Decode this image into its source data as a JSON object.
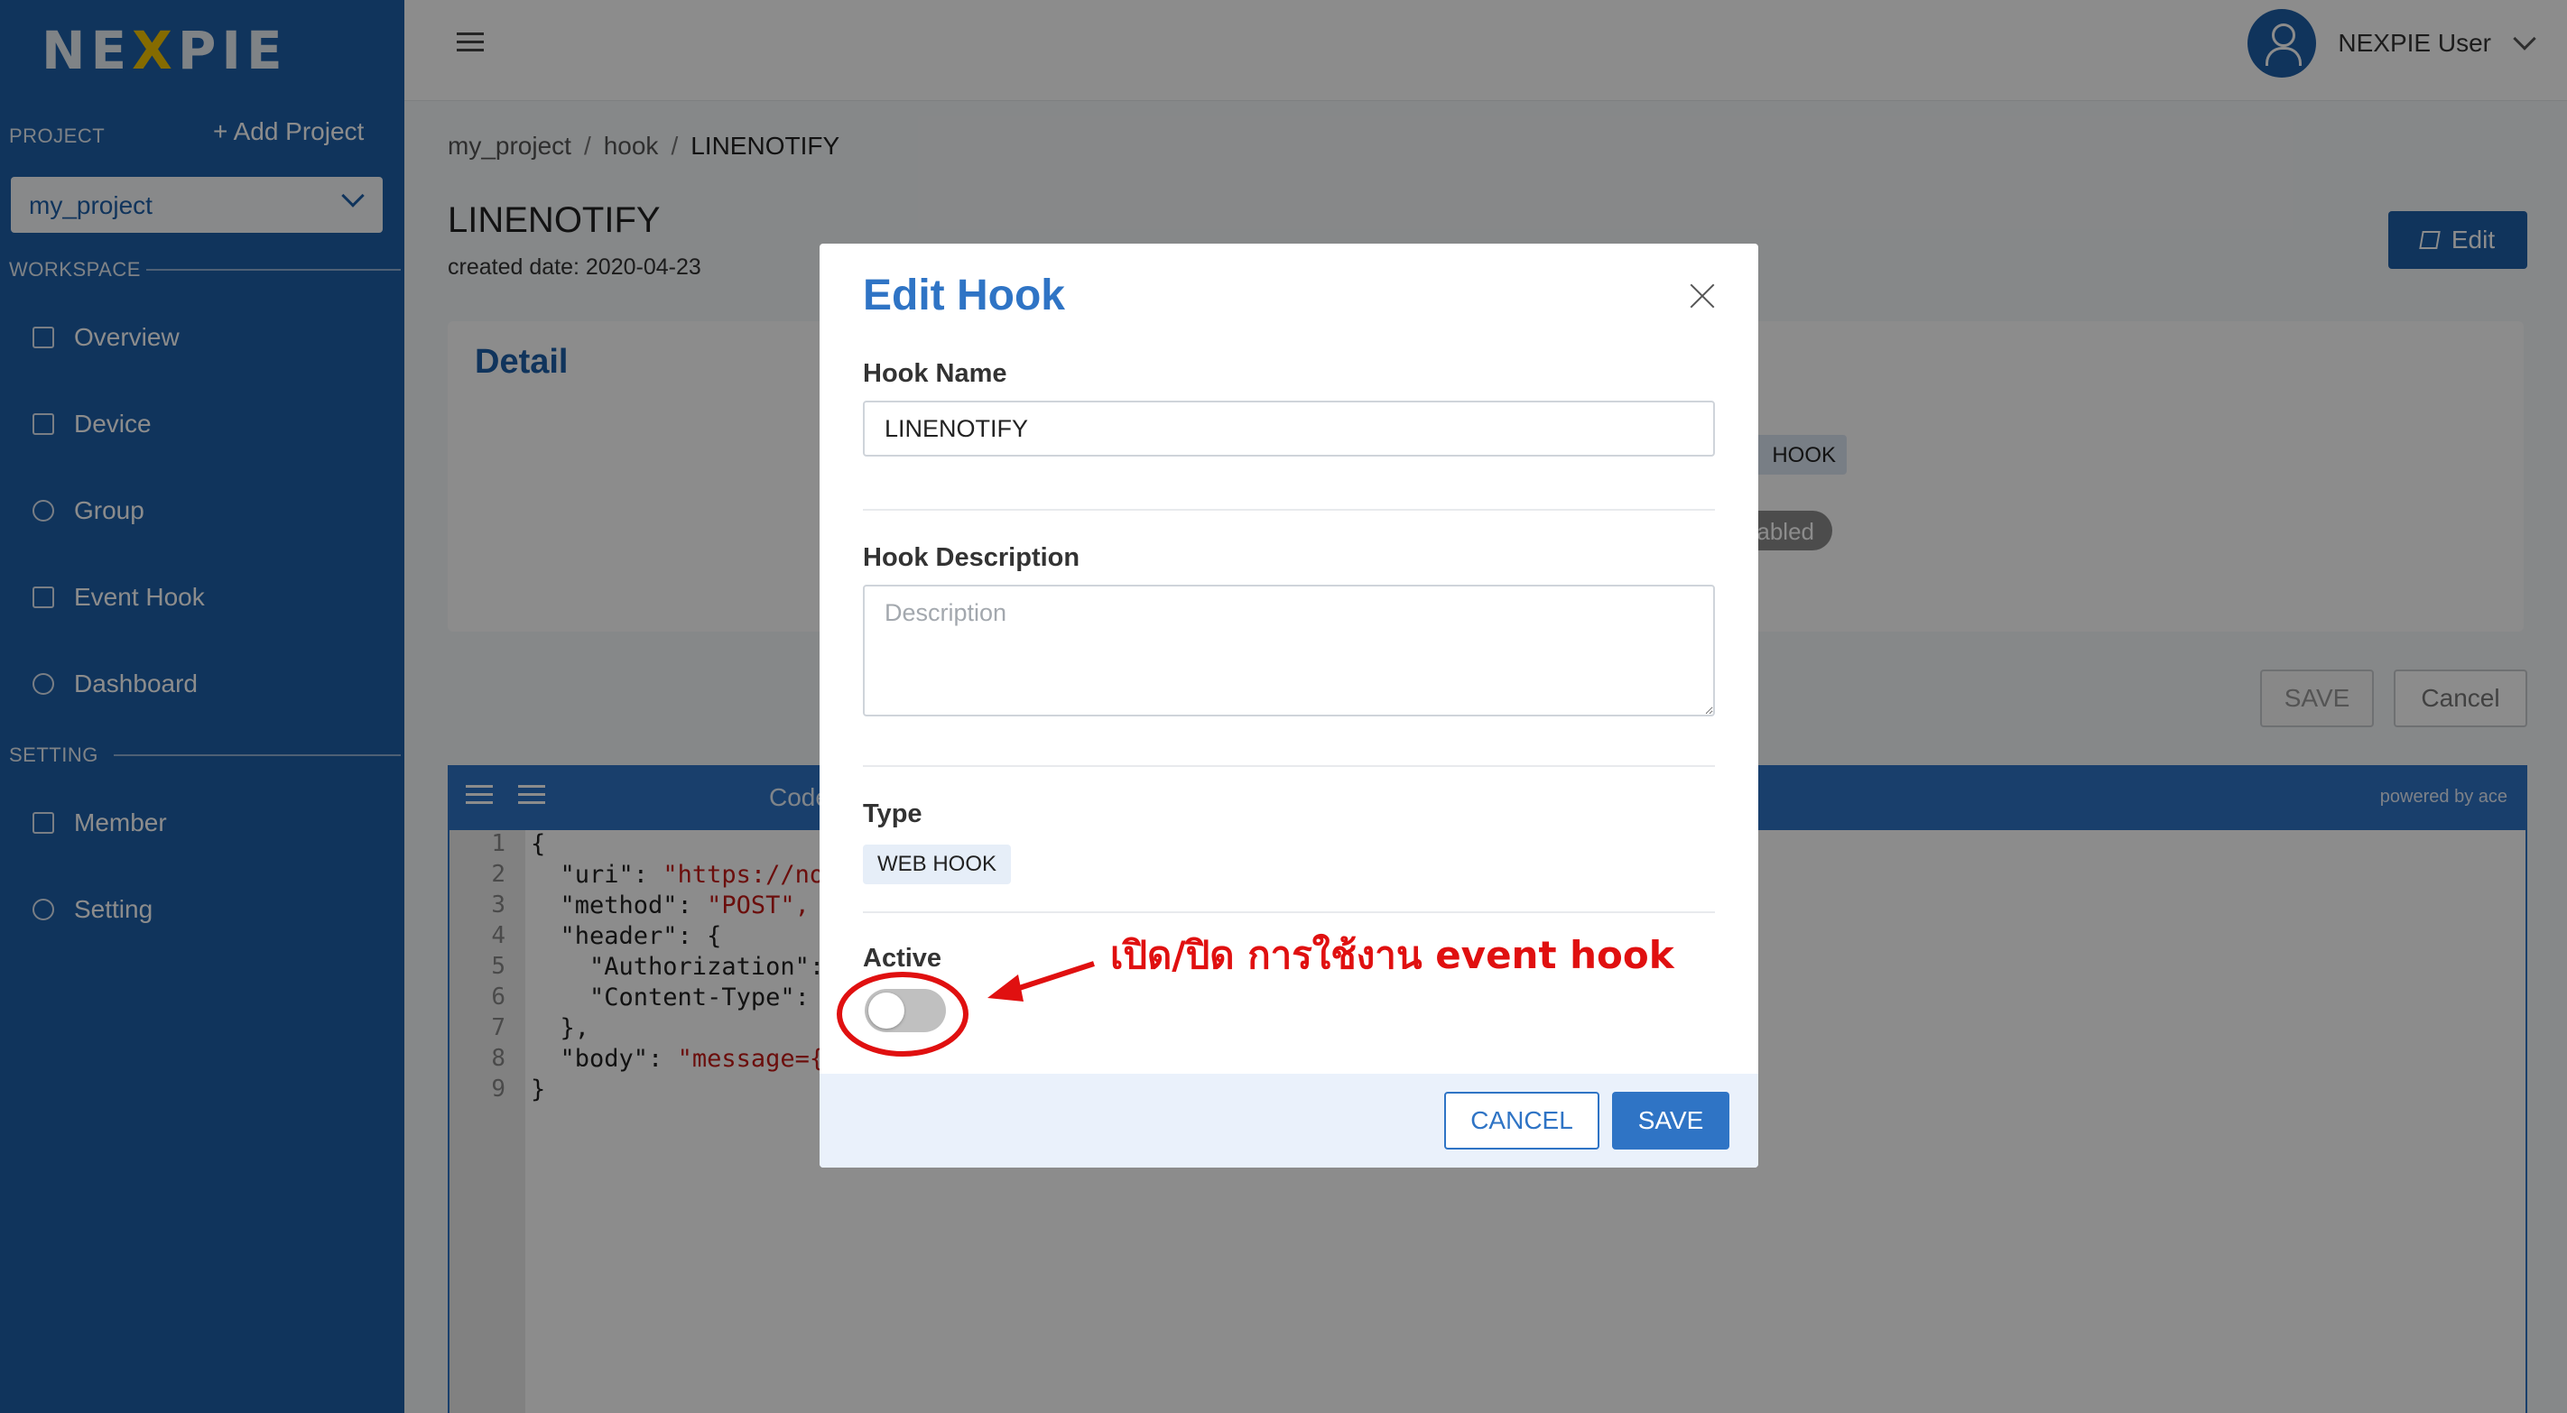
{
  "app": {
    "logo": "NEXPIE"
  },
  "sidebar": {
    "project_label": "PROJECT",
    "add_project": "+ Add Project",
    "selected_project": "my_project",
    "workspace_label": "WORKSPACE",
    "setting_label": "SETTING",
    "workspace_items": [
      {
        "label": "Overview",
        "icon": "grid-icon"
      },
      {
        "label": "Device",
        "icon": "device-icon"
      },
      {
        "label": "Group",
        "icon": "tag-icon"
      },
      {
        "label": "Event Hook",
        "icon": "terminal-icon"
      },
      {
        "label": "Dashboard",
        "icon": "gauge-icon"
      }
    ],
    "setting_items": [
      {
        "label": "Member",
        "icon": "member-icon"
      },
      {
        "label": "Setting",
        "icon": "gear-icon"
      }
    ]
  },
  "header": {
    "user_name": "NEXPIE User"
  },
  "breadcrumb": [
    "my_project",
    "hook",
    "LINENOTIFY"
  ],
  "page": {
    "title": "LINENOTIFY",
    "created": "created date: 2020-04-23",
    "edit_button": "Edit",
    "detail_title": "Detail",
    "type_tag": "HOOK",
    "status_tag": "abled",
    "save_button": "SAVE",
    "cancel_button": "Cancel"
  },
  "editor": {
    "code_label": "Code",
    "powered_by": "powered by ace",
    "line_numbers": [
      "1",
      "2",
      "3",
      "4",
      "5",
      "6",
      "7",
      "8",
      "9"
    ],
    "lines": [
      {
        "text": "{",
        "str": ""
      },
      {
        "text": "  \"uri\": ",
        "str": "\"https://not"
      },
      {
        "text": "  \"method\": ",
        "str": "\"POST\","
      },
      {
        "text": "  \"header\": {",
        "str": ""
      },
      {
        "text": "    \"Authorization\": ",
        "str": ""
      },
      {
        "text": "    \"Content-Type\": ",
        "str": "\""
      },
      {
        "text": "  },",
        "str": ""
      },
      {
        "text": "  \"body\": ",
        "str": "\"message={"
      },
      {
        "text": "}",
        "str": ""
      }
    ]
  },
  "modal": {
    "title": "Edit Hook",
    "hook_name_label": "Hook Name",
    "hook_name_value": "LINENOTIFY",
    "description_label": "Hook Description",
    "description_placeholder": "Description",
    "type_label": "Type",
    "type_value": "WEB HOOK",
    "active_label": "Active",
    "active": false,
    "cancel_button": "CANCEL",
    "save_button": "SAVE"
  },
  "annotation": {
    "text": "เปิด/ปิด การใช้งาน event hook",
    "color": "#e01010"
  },
  "colors": {
    "primary": "#1e5fa8",
    "accent": "#2f74c5"
  }
}
